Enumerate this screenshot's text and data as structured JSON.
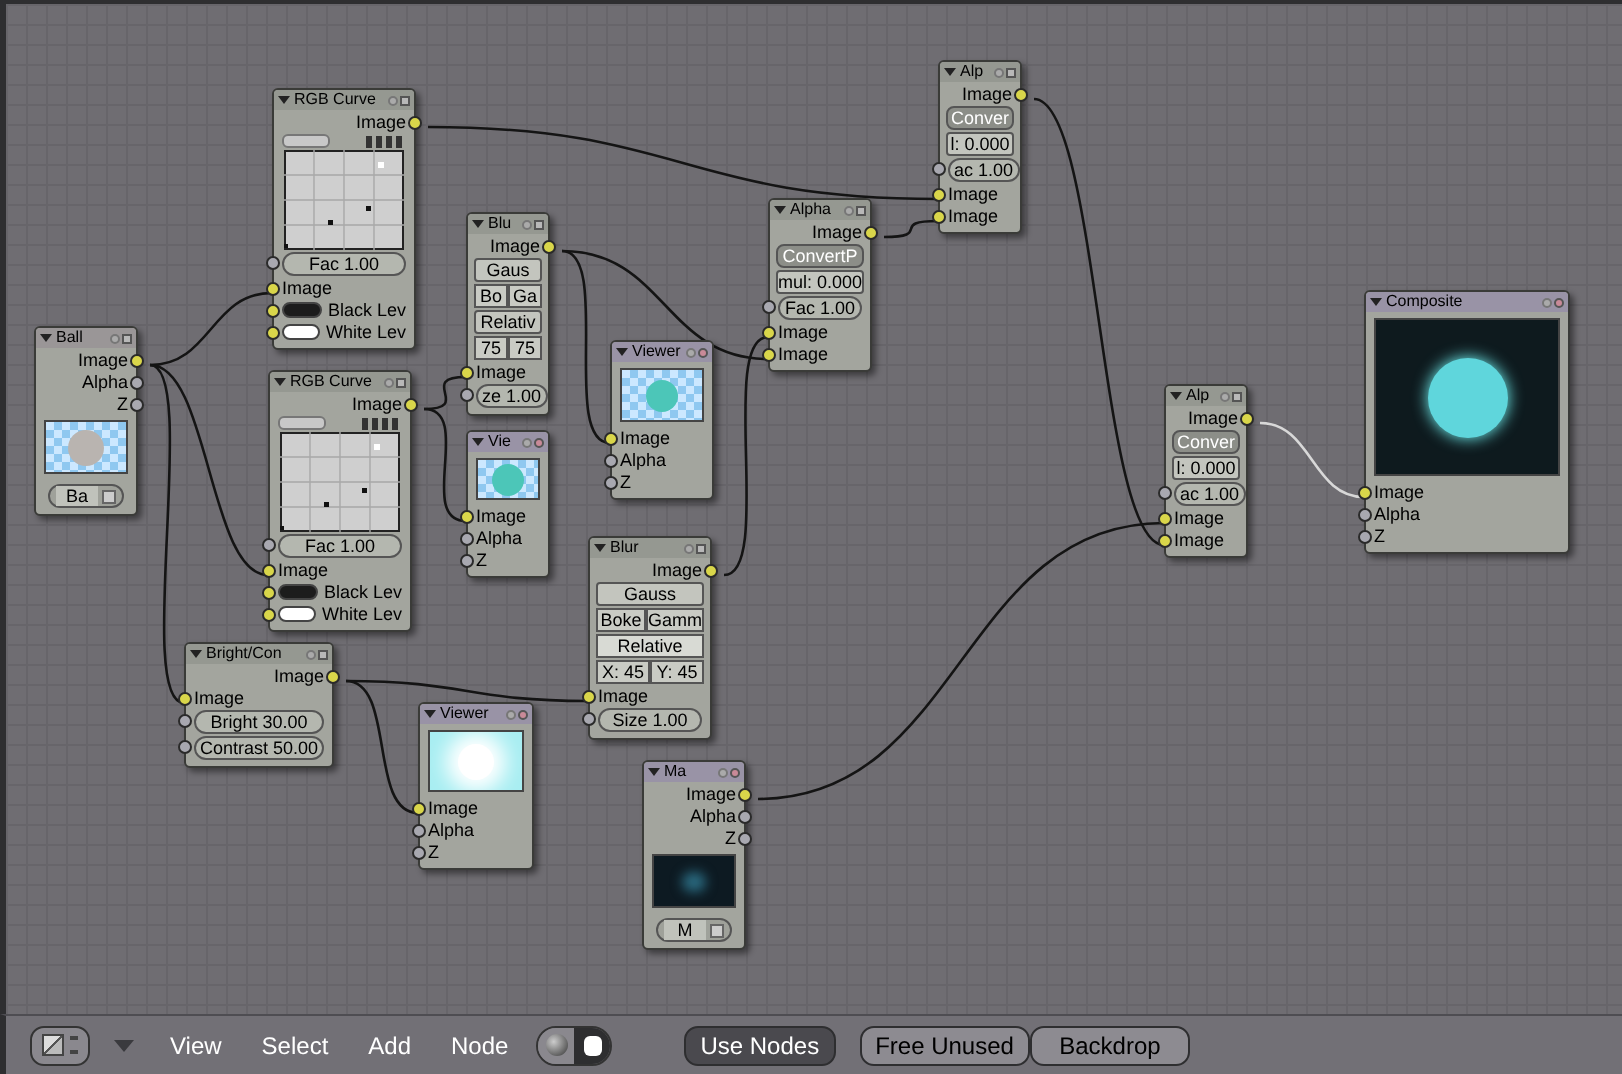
{
  "nodes": [
    {
      "title": "RGB Curve",
      "kind": "operator",
      "rows": [
        {
          "kind": "out",
          "label": "Image",
          "image_socket": true
        },
        {
          "kind": "curve"
        },
        {
          "kind": "num",
          "label": "Fac 1.00",
          "image_socket": false
        },
        {
          "kind": "in",
          "label": "Image",
          "image_socket": true
        },
        {
          "kind": "swatch",
          "label": "Black Lev",
          "color": "#1c1c1c"
        },
        {
          "kind": "swatch",
          "label": "White Lev",
          "color": "#ffffff"
        }
      ]
    },
    {
      "title": "RGB Curve",
      "kind": "operator",
      "rows": [
        {
          "kind": "out",
          "label": "Image",
          "image_socket": true
        },
        {
          "kind": "curve"
        },
        {
          "kind": "num",
          "label": "Fac 1.00",
          "image_socket": false
        },
        {
          "kind": "in",
          "label": "Image",
          "image_socket": true
        },
        {
          "kind": "swatch",
          "label": "Black Lev",
          "color": "#1c1c1c"
        },
        {
          "kind": "swatch",
          "label": "White Lev",
          "color": "#ffffff"
        }
      ]
    },
    {
      "title": "Ball",
      "kind": "input",
      "rows": [
        {
          "kind": "out",
          "label": "Image",
          "image_socket": true
        },
        {
          "kind": "out",
          "label": "Alpha",
          "image_socket": false
        },
        {
          "kind": "out",
          "label": "Z",
          "image_socket": false
        },
        {
          "kind": "preview-grey"
        },
        {
          "kind": "select",
          "label": "Ba"
        }
      ]
    },
    {
      "title": "Blu",
      "kind": "operator",
      "rows": [
        {
          "kind": "out",
          "label": "Image",
          "image_socket": true
        },
        {
          "kind": "button",
          "label": "Gaus"
        },
        {
          "kind": "pair",
          "labels": [
            "Bo",
            "Ga"
          ]
        },
        {
          "kind": "button",
          "label": "Relativ"
        },
        {
          "kind": "pair",
          "labels": [
            "75",
            "75"
          ]
        },
        {
          "kind": "in",
          "label": "Image",
          "image_socket": true
        },
        {
          "kind": "num",
          "label": "ze 1.00",
          "image_socket": false
        }
      ]
    },
    {
      "title": "Vie",
      "kind": "output",
      "rows": [
        {
          "kind": "preview-teal"
        },
        {
          "kind": "in",
          "label": "Image",
          "image_socket": true
        },
        {
          "kind": "in",
          "label": "Alpha",
          "image_socket": false
        },
        {
          "kind": "in",
          "label": "Z",
          "image_socket": false
        }
      ]
    },
    {
      "title": "Viewer",
      "kind": "output",
      "rows": [
        {
          "kind": "preview-teal"
        },
        {
          "kind": "in",
          "label": "Image",
          "image_socket": true
        },
        {
          "kind": "in",
          "label": "Alpha",
          "image_socket": false
        },
        {
          "kind": "in",
          "label": "Z",
          "image_socket": false
        }
      ]
    },
    {
      "title": "Alpha",
      "kind": "operator",
      "rows": [
        {
          "kind": "out",
          "label": "Image",
          "image_socket": true
        },
        {
          "kind": "toggle",
          "label": "ConvertP"
        },
        {
          "kind": "button",
          "label": "mul: 0.000"
        },
        {
          "kind": "num",
          "label": "Fac 1.00",
          "image_socket": false
        },
        {
          "kind": "in",
          "label": "Image",
          "image_socket": true
        },
        {
          "kind": "in",
          "label": "Image",
          "image_socket": true
        }
      ]
    },
    {
      "title": "Alp",
      "kind": "operator",
      "rows": [
        {
          "kind": "out",
          "label": "Image",
          "image_socket": true
        },
        {
          "kind": "toggle",
          "label": "Conver"
        },
        {
          "kind": "button",
          "label": "l: 0.000"
        },
        {
          "kind": "num",
          "label": "ac 1.00",
          "image_socket": false
        },
        {
          "kind": "in",
          "label": "Image",
          "image_socket": true
        },
        {
          "kind": "in",
          "label": "Image",
          "image_socket": true
        }
      ]
    },
    {
      "title": "Alp",
      "kind": "operator",
      "rows": [
        {
          "kind": "out",
          "label": "Image",
          "image_socket": true
        },
        {
          "kind": "toggle",
          "label": "Conver"
        },
        {
          "kind": "button",
          "label": "l: 0.000"
        },
        {
          "kind": "num",
          "label": "ac 1.00",
          "image_socket": false
        },
        {
          "kind": "in",
          "label": "Image",
          "image_socket": true
        },
        {
          "kind": "in",
          "label": "Image",
          "image_socket": true
        }
      ]
    },
    {
      "title": "Composite",
      "kind": "output",
      "rows": [
        {
          "kind": "preview-render"
        },
        {
          "kind": "in",
          "label": "Image",
          "image_socket": true
        },
        {
          "kind": "in",
          "label": "Alpha",
          "image_socket": false
        },
        {
          "kind": "in",
          "label": "Z",
          "image_socket": false
        }
      ]
    },
    {
      "title": "Blur",
      "kind": "operator",
      "rows": [
        {
          "kind": "out",
          "label": "Image",
          "image_socket": true
        },
        {
          "kind": "button",
          "label": "Gauss"
        },
        {
          "kind": "pair",
          "labels": [
            "Boke",
            "Gamm"
          ]
        },
        {
          "kind": "toggle-light",
          "label": "Relative"
        },
        {
          "kind": "pair",
          "labels": [
            "X: 45",
            "Y: 45"
          ]
        },
        {
          "kind": "in",
          "label": "Image",
          "image_socket": true
        },
        {
          "kind": "num",
          "label": "Size 1.00",
          "image_socket": false
        }
      ]
    },
    {
      "title": "Bright/Con",
      "kind": "operator",
      "rows": [
        {
          "kind": "out",
          "label": "Image",
          "image_socket": true
        },
        {
          "kind": "in",
          "label": "Image",
          "image_socket": true
        },
        {
          "kind": "num",
          "label": "Bright 30.00",
          "image_socket": false
        },
        {
          "kind": "num",
          "label": "Contrast 50.00",
          "image_socket": false
        }
      ]
    },
    {
      "title": "Viewer",
      "kind": "output",
      "rows": [
        {
          "kind": "preview-white"
        },
        {
          "kind": "in",
          "label": "Image",
          "image_socket": true
        },
        {
          "kind": "in",
          "label": "Alpha",
          "image_socket": false
        },
        {
          "kind": "in",
          "label": "Z",
          "image_socket": false
        }
      ]
    },
    {
      "title": "Ma",
      "kind": "output",
      "rows": [
        {
          "kind": "out",
          "label": "Image",
          "image_socket": true
        },
        {
          "kind": "out",
          "label": "Alpha",
          "image_socket": false
        },
        {
          "kind": "out",
          "label": "Z",
          "image_socket": false
        },
        {
          "kind": "preview-dark"
        },
        {
          "kind": "select",
          "label": "M"
        }
      ]
    }
  ],
  "header": {
    "menus": [
      "View",
      "Select",
      "Add",
      "Node"
    ],
    "tree_types": [
      {
        "kind": "material",
        "selected": false
      },
      {
        "kind": "composite",
        "selected": true
      }
    ],
    "buttons": [
      {
        "label": "Use Nodes",
        "selected": true
      },
      {
        "label": "Free Unused",
        "selected": false
      },
      {
        "label": "Backdrop",
        "selected": false
      }
    ]
  }
}
